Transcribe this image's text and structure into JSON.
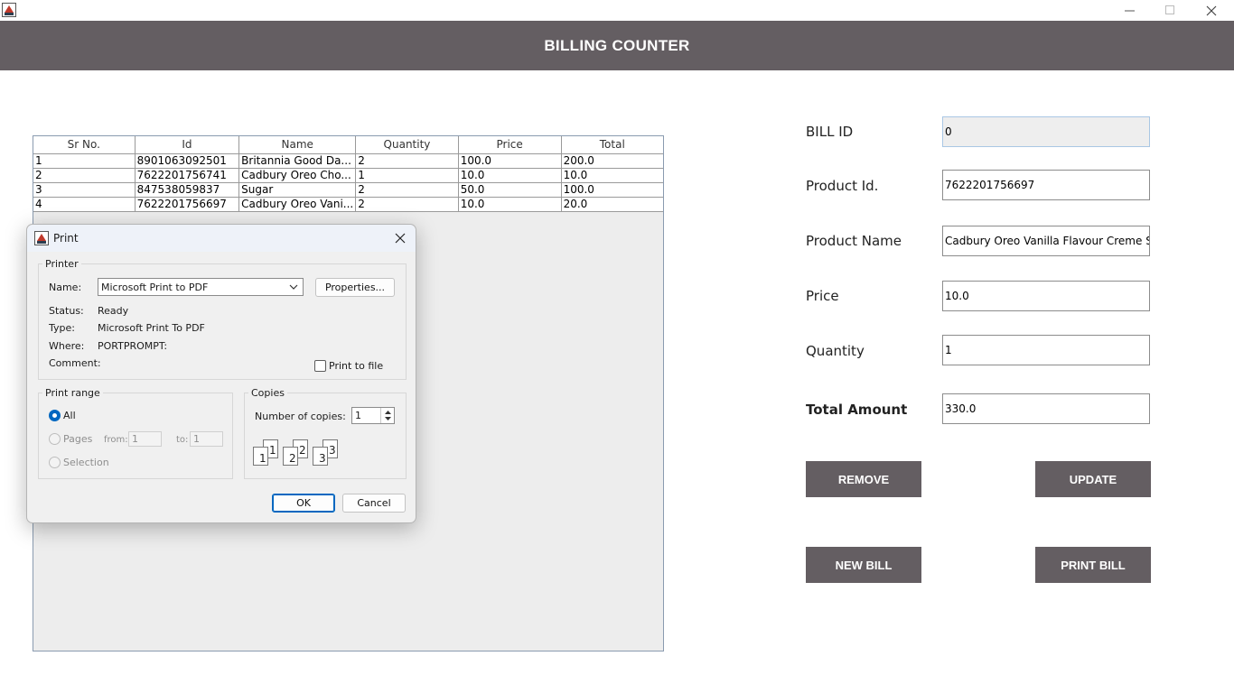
{
  "window": {
    "title_icon": "java-coffee-icon",
    "header_title": "BILLING COUNTER"
  },
  "table": {
    "columns": [
      "Sr No.",
      "Id",
      "Name",
      "Quantity",
      "Price",
      "Total"
    ],
    "rows": [
      [
        "1",
        "8901063092501",
        "Britannia Good Da...",
        "2",
        "100.0",
        "200.0"
      ],
      [
        "2",
        "7622201756741",
        "Cadbury Oreo Cho...",
        "1",
        "10.0",
        "10.0"
      ],
      [
        "3",
        "847538059837",
        "Sugar",
        "2",
        "50.0",
        "100.0"
      ],
      [
        "4",
        "7622201756697",
        "Cadbury Oreo Vani...",
        "2",
        "10.0",
        "20.0"
      ]
    ]
  },
  "form": {
    "bill_id_label": "BILL ID",
    "bill_id_value": "0",
    "product_id_label": "Product Id.",
    "product_id_value": "7622201756697",
    "product_name_label": "Product Name",
    "product_name_value": "Cadbury Oreo Vanilla Flavour Creme Sa",
    "price_label": "Price",
    "price_value": "10.0",
    "quantity_label": "Quantity",
    "quantity_value": "1",
    "total_label": "Total Amount",
    "total_value": "330.0"
  },
  "buttons": {
    "remove": "REMOVE",
    "update": "UPDATE",
    "new_bill": "NEW BILL",
    "print_bill": "PRINT BILL"
  },
  "print_dialog": {
    "title": "Print",
    "printer_group": "Printer",
    "name_label": "Name:",
    "printer_name": "Microsoft Print to PDF",
    "properties_button": "Properties...",
    "status_label": "Status:",
    "status_value": "Ready",
    "type_label": "Type:",
    "type_value": "Microsoft Print To PDF",
    "where_label": "Where:",
    "where_value": "PORTPROMPT:",
    "comment_label": "Comment:",
    "print_to_file": "Print to file",
    "range_group": "Print range",
    "range_all": "All",
    "range_pages": "Pages",
    "from_label": "from:",
    "from_value": "1",
    "to_label": "to:",
    "to_value": "1",
    "range_selection": "Selection",
    "copies_group": "Copies",
    "copies_label": "Number of copies:",
    "copies_value": "1",
    "collate_icons": [
      "1",
      "1",
      "2",
      "2",
      "3",
      "3"
    ],
    "ok_button": "OK",
    "cancel_button": "Cancel"
  }
}
